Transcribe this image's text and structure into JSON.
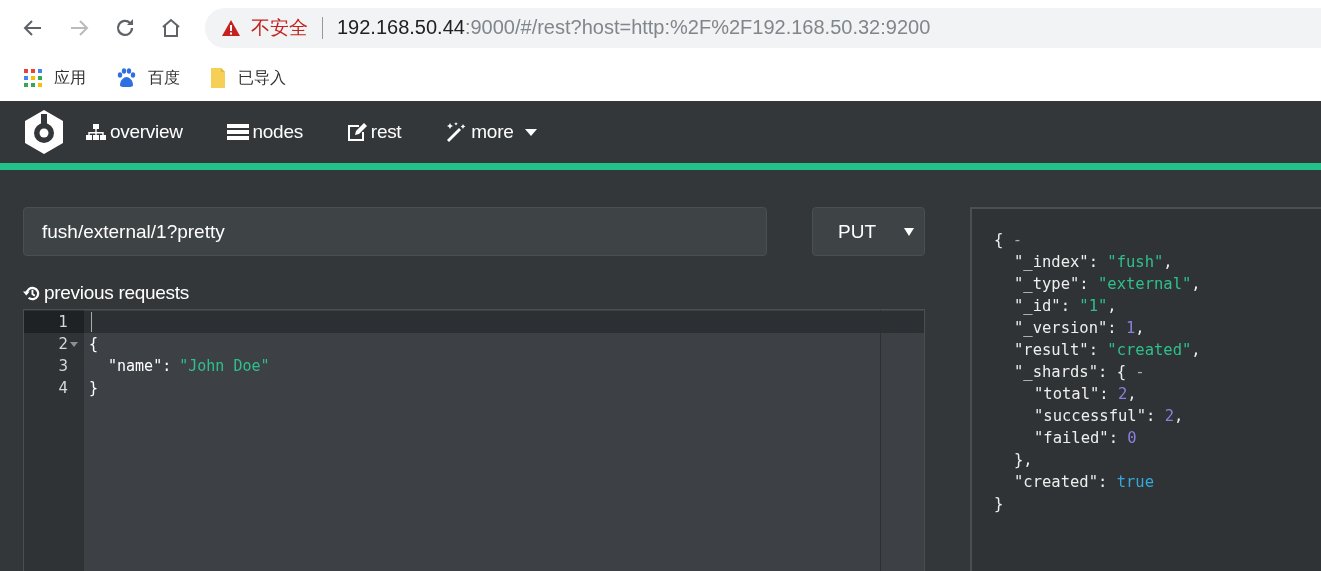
{
  "browser": {
    "back_disabled": false,
    "forward_disabled": true,
    "security": "不安全",
    "url_host": "192.168.50.44",
    "url_rest": ":9000/#/rest?host=http:%2F%2F192.168.50.32:9200",
    "bookmarks": [
      {
        "label": "应用",
        "kind": "apps"
      },
      {
        "label": "百度",
        "kind": "paw"
      },
      {
        "label": "已导入",
        "kind": "folder"
      }
    ]
  },
  "nav": {
    "items": [
      {
        "label": "overview",
        "kind": "sitemap",
        "dropdown": false
      },
      {
        "label": "nodes",
        "kind": "server",
        "dropdown": false
      },
      {
        "label": "rest",
        "kind": "edit",
        "dropdown": false
      },
      {
        "label": "more",
        "kind": "wand",
        "dropdown": true
      }
    ]
  },
  "request": {
    "path": "fush/external/1?pretty",
    "method": "PUT",
    "history_label": "previous requests"
  },
  "editor": {
    "lines": [
      {
        "number": "1",
        "selected": true,
        "indented": false
      },
      {
        "number": "2",
        "selected": false,
        "indented": false,
        "tokens": [
          {
            "text": "{",
            "kind": "open"
          }
        ]
      },
      {
        "number": "3",
        "selected": false,
        "indented": true,
        "tokens": [
          {
            "text": "\"name\":",
            "kind": "key"
          },
          {
            "text": "\"John Doe\"",
            "kind": "string"
          }
        ]
      },
      {
        "number": "4",
        "selected": false,
        "indented": false,
        "tokens": [
          {
            "text": "}",
            "kind": "close"
          }
        ]
      }
    ]
  },
  "response": {
    "open": "{",
    "fold": "-",
    "close": "}",
    "entries": [
      {
        "key": "\"_index\":",
        "value": "\"fush\"",
        "kind": "string",
        "comma": ","
      },
      {
        "key": "\"_type\":",
        "value": "\"external\"",
        "kind": "string",
        "comma": ","
      },
      {
        "key": "\"_id\":",
        "value": "\"1\"",
        "kind": "string",
        "comma": ","
      },
      {
        "key": "\"_version\":",
        "value": "1",
        "kind": "number",
        "comma": ","
      },
      {
        "key": "\"result\":",
        "value": "\"created\"",
        "kind": "string",
        "comma": ","
      },
      {
        "key": "\"_shards\":",
        "kind": "object",
        "open": "{",
        "fold": "-",
        "close": "},",
        "entries": [
          {
            "key": "\"total\":",
            "value": "2",
            "kind": "number",
            "comma": ","
          },
          {
            "key": "\"successful\":",
            "value": "2",
            "kind": "number",
            "comma": ","
          },
          {
            "key": "\"failed\":",
            "value": "0",
            "kind": "number"
          }
        ]
      },
      {
        "key": "\"created\":",
        "value": "true",
        "kind": "bool"
      }
    ]
  }
}
